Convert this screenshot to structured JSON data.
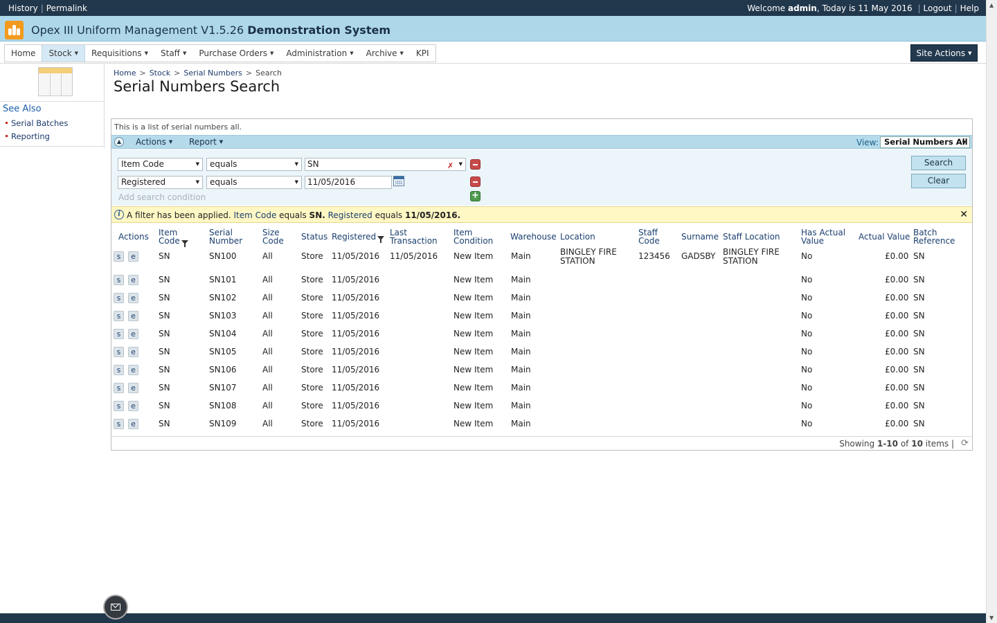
{
  "topbar": {
    "history": "History",
    "permalink": "Permalink",
    "welcome_prefix": "Welcome",
    "user": "admin",
    "today_text": ", Today is 11 May 2016",
    "logout": "Logout",
    "help": "Help"
  },
  "app": {
    "title": "Opex III Uniform Management V1.5.26",
    "system": "Demonstration System"
  },
  "nav": {
    "items": [
      "Home",
      "Stock",
      "Requisitions",
      "Staff",
      "Purchase Orders",
      "Administration",
      "Archive",
      "KPI"
    ],
    "site_actions": "Site Actions"
  },
  "see_also": {
    "heading": "See Also",
    "links": [
      "Serial Batches",
      "Reporting"
    ]
  },
  "breadcrumb": [
    "Home",
    "Stock",
    "Serial Numbers",
    "Search"
  ],
  "page_title": "Serial Numbers Search",
  "description": "This is a list of serial numbers all.",
  "toolbar": {
    "actions": "Actions",
    "report": "Report",
    "view_label": "View:",
    "view_value": "Serial Numbers All"
  },
  "filters": [
    {
      "field": "Item Code",
      "operator": "equals",
      "value": "SN"
    },
    {
      "field": "Registered",
      "operator": "equals",
      "value": "11/05/2016"
    }
  ],
  "add_condition": "Add search condition",
  "search_button": "Search",
  "clear_button": "Clear",
  "filter_note": {
    "prefix": "A filter has been applied.",
    "k1": "Item Code",
    "op1": "equals",
    "v1": "SN.",
    "k2": "Registered",
    "op2": "equals",
    "v2": "11/05/2016."
  },
  "columns": [
    "Actions",
    "Item Code",
    "Serial Number",
    "Size Code",
    "Status",
    "Registered",
    "Last Transaction",
    "Item Condition",
    "Warehouse",
    "Location",
    "Staff Code",
    "Surname",
    "Staff Location",
    "Has Actual Value",
    "Actual Value",
    "Batch Reference"
  ],
  "row_buttons": {
    "select": "s",
    "edit": "e"
  },
  "rows": [
    {
      "item_code": "SN",
      "serial": "SN100",
      "size": "All",
      "status": "Store",
      "registered": "11/05/2016",
      "last_tx": "11/05/2016",
      "condition": "New Item",
      "warehouse": "Main",
      "location": "BINGLEY FIRE STATION",
      "staff_code": "123456",
      "surname": "GADSBY",
      "staff_location": "BINGLEY FIRE STATION",
      "has_actual": "No",
      "actual_value": "£0.00",
      "batch": "SN"
    },
    {
      "item_code": "SN",
      "serial": "SN101",
      "size": "All",
      "status": "Store",
      "registered": "11/05/2016",
      "last_tx": "",
      "condition": "New Item",
      "warehouse": "Main",
      "location": "",
      "staff_code": "",
      "surname": "",
      "staff_location": "",
      "has_actual": "No",
      "actual_value": "£0.00",
      "batch": "SN"
    },
    {
      "item_code": "SN",
      "serial": "SN102",
      "size": "All",
      "status": "Store",
      "registered": "11/05/2016",
      "last_tx": "",
      "condition": "New Item",
      "warehouse": "Main",
      "location": "",
      "staff_code": "",
      "surname": "",
      "staff_location": "",
      "has_actual": "No",
      "actual_value": "£0.00",
      "batch": "SN"
    },
    {
      "item_code": "SN",
      "serial": "SN103",
      "size": "All",
      "status": "Store",
      "registered": "11/05/2016",
      "last_tx": "",
      "condition": "New Item",
      "warehouse": "Main",
      "location": "",
      "staff_code": "",
      "surname": "",
      "staff_location": "",
      "has_actual": "No",
      "actual_value": "£0.00",
      "batch": "SN"
    },
    {
      "item_code": "SN",
      "serial": "SN104",
      "size": "All",
      "status": "Store",
      "registered": "11/05/2016",
      "last_tx": "",
      "condition": "New Item",
      "warehouse": "Main",
      "location": "",
      "staff_code": "",
      "surname": "",
      "staff_location": "",
      "has_actual": "No",
      "actual_value": "£0.00",
      "batch": "SN"
    },
    {
      "item_code": "SN",
      "serial": "SN105",
      "size": "All",
      "status": "Store",
      "registered": "11/05/2016",
      "last_tx": "",
      "condition": "New Item",
      "warehouse": "Main",
      "location": "",
      "staff_code": "",
      "surname": "",
      "staff_location": "",
      "has_actual": "No",
      "actual_value": "£0.00",
      "batch": "SN"
    },
    {
      "item_code": "SN",
      "serial": "SN106",
      "size": "All",
      "status": "Store",
      "registered": "11/05/2016",
      "last_tx": "",
      "condition": "New Item",
      "warehouse": "Main",
      "location": "",
      "staff_code": "",
      "surname": "",
      "staff_location": "",
      "has_actual": "No",
      "actual_value": "£0.00",
      "batch": "SN"
    },
    {
      "item_code": "SN",
      "serial": "SN107",
      "size": "All",
      "status": "Store",
      "registered": "11/05/2016",
      "last_tx": "",
      "condition": "New Item",
      "warehouse": "Main",
      "location": "",
      "staff_code": "",
      "surname": "",
      "staff_location": "",
      "has_actual": "No",
      "actual_value": "£0.00",
      "batch": "SN"
    },
    {
      "item_code": "SN",
      "serial": "SN108",
      "size": "All",
      "status": "Store",
      "registered": "11/05/2016",
      "last_tx": "",
      "condition": "New Item",
      "warehouse": "Main",
      "location": "",
      "staff_code": "",
      "surname": "",
      "staff_location": "",
      "has_actual": "No",
      "actual_value": "£0.00",
      "batch": "SN"
    },
    {
      "item_code": "SN",
      "serial": "SN109",
      "size": "All",
      "status": "Store",
      "registered": "11/05/2016",
      "last_tx": "",
      "condition": "New Item",
      "warehouse": "Main",
      "location": "",
      "staff_code": "",
      "surname": "",
      "staff_location": "",
      "has_actual": "No",
      "actual_value": "£0.00",
      "batch": "SN"
    }
  ],
  "pager": {
    "showing": "Showing",
    "range": "1-10",
    "of": "of",
    "total": "10",
    "items": "items |"
  }
}
